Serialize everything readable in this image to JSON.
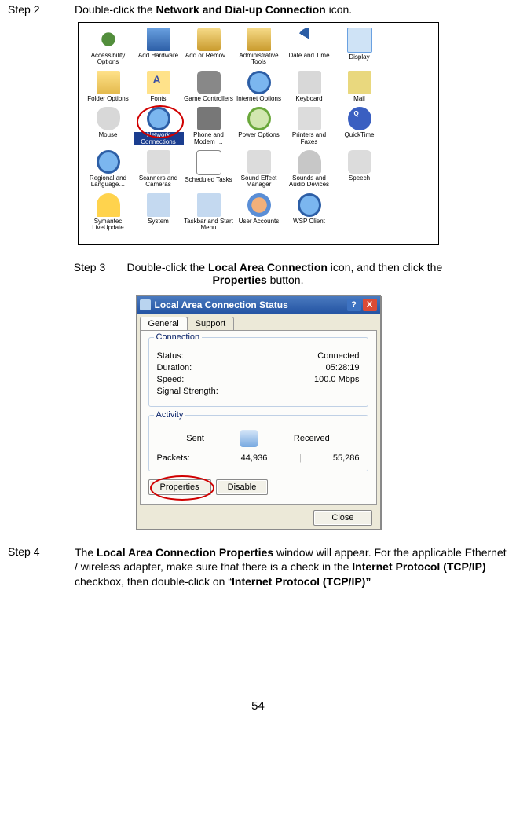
{
  "step2": {
    "label": "Step 2",
    "text_pre": "Double-click the ",
    "bold": "Network and Dial-up Connection",
    "text_post": " icon."
  },
  "cp_items": [
    {
      "name": "Accessibility Options",
      "icon": "ic-access"
    },
    {
      "name": "Add Hardware",
      "icon": "ic-addhw"
    },
    {
      "name": "Add or Remov…",
      "icon": "ic-addrem"
    },
    {
      "name": "Administrative Tools",
      "icon": "ic-admin"
    },
    {
      "name": "Date and Time",
      "icon": "ic-date"
    },
    {
      "name": "Display",
      "icon": "ic-display"
    },
    {
      "name": "Folder Options",
      "icon": "ic-folder"
    },
    {
      "name": "Fonts",
      "icon": "ic-fonts"
    },
    {
      "name": "Game Controllers",
      "icon": "ic-game"
    },
    {
      "name": "Internet Options",
      "icon": "ic-inet"
    },
    {
      "name": "Keyboard",
      "icon": "ic-keyb"
    },
    {
      "name": "Mail",
      "icon": "ic-mail"
    },
    {
      "name": "Mouse",
      "icon": "ic-mouse"
    },
    {
      "name": "Network Connections",
      "icon": "ic-net",
      "highlighted": true
    },
    {
      "name": "Phone and Modem …",
      "icon": "ic-phone"
    },
    {
      "name": "Power Options",
      "icon": "ic-power"
    },
    {
      "name": "Printers and Faxes",
      "icon": "ic-print"
    },
    {
      "name": "QuickTime",
      "icon": "ic-qt"
    },
    {
      "name": "Regional and Language…",
      "icon": "ic-region"
    },
    {
      "name": "Scanners and Cameras",
      "icon": "ic-scanner"
    },
    {
      "name": "Scheduled Tasks",
      "icon": "ic-sched"
    },
    {
      "name": "Sound Effect Manager",
      "icon": "ic-sound"
    },
    {
      "name": "Sounds and Audio Devices",
      "icon": "ic-sounds"
    },
    {
      "name": "Speech",
      "icon": "ic-speech"
    },
    {
      "name": "Symantec LiveUpdate",
      "icon": "ic-sym"
    },
    {
      "name": "System",
      "icon": "ic-system"
    },
    {
      "name": "Taskbar and Start Menu",
      "icon": "ic-taskbar"
    },
    {
      "name": "User Accounts",
      "icon": "ic-user"
    },
    {
      "name": "WSP Client",
      "icon": "ic-wsp"
    }
  ],
  "step3": {
    "label": "Step 3",
    "pre": "Double-click the ",
    "b1": "Local Area Connection",
    "mid": " icon, and then click the ",
    "b2": "Properties",
    "post": " button."
  },
  "lac": {
    "title": "Local Area Connection Status",
    "help": "?",
    "close_x": "X",
    "tabs": {
      "general": "General",
      "support": "Support"
    },
    "conn_group": "Connection",
    "status_k": "Status:",
    "status_v": "Connected",
    "duration_k": "Duration:",
    "duration_v": "05:28:19",
    "speed_k": "Speed:",
    "speed_v": "100.0 Mbps",
    "signal_k": "Signal Strength:",
    "activity_group": "Activity",
    "sent": "Sent",
    "received": "Received",
    "packets_lbl": "Packets:",
    "packets_sent": "44,936",
    "packets_recv": "55,286",
    "btn_properties": "Properties",
    "btn_disable": "Disable",
    "btn_close": "Close"
  },
  "step4": {
    "label": "Step 4",
    "t1": "The ",
    "b1": "Local Area Connection Properties",
    "t2": " window will appear. For the applicable Ethernet / wireless adapter, make sure that there is a check in the ",
    "b2": "Internet Protocol (TCP/IP)",
    "t3": " checkbox, then double-click on “",
    "b3": "Internet Protocol (TCP/IP)”"
  },
  "page_number": "54"
}
